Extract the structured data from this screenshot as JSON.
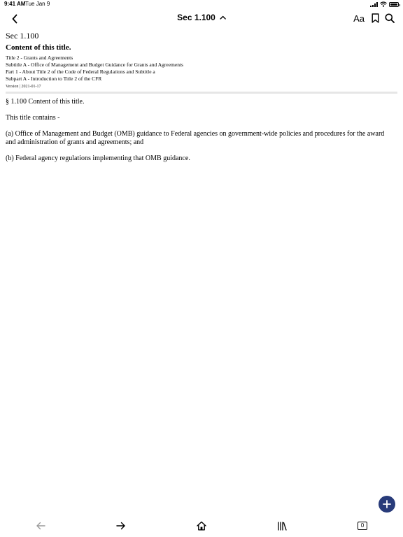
{
  "status_bar": {
    "time": "9:41 AM",
    "date": "Tue Jan 9"
  },
  "nav": {
    "title": "Sec 1.100",
    "font_button": "Aa",
    "icons": [
      "chevron-left-icon",
      "chevron-up-icon",
      "bookmark-icon",
      "search-icon"
    ]
  },
  "header": {
    "section": "Sec 1.100",
    "title": "Content of this title.",
    "breadcrumbs": [
      "Title 2 - Grants and Agreements",
      "Subtitle A - Office of Management and Budget Guidance for Grants and Agreements",
      "Part 1 - About Title 2 of the Code of Federal Regulations and Subtitle a",
      "Subpart A - Introduction to Title 2 of the CFR"
    ],
    "version": "Version | 2021-01-17"
  },
  "body": {
    "paragraphs": [
      "§ 1.100 Content of this title.",
      "This title contains -",
      "(a) Office of Management and Budget (OMB) guidance to Federal agencies on government-wide policies and procedures for the award and administration of grants and agreements; and",
      "(b) Federal agency regulations implementing that OMB guidance."
    ]
  },
  "toolbar": {
    "tab_count": "0",
    "icons": [
      "arrow-left-icon",
      "arrow-right-icon",
      "home-icon",
      "library-icon",
      "tabs-icon"
    ]
  },
  "colors": {
    "fab": "#283b7a",
    "disabled": "#9a9a9a",
    "divider": "#e6e6e6"
  }
}
